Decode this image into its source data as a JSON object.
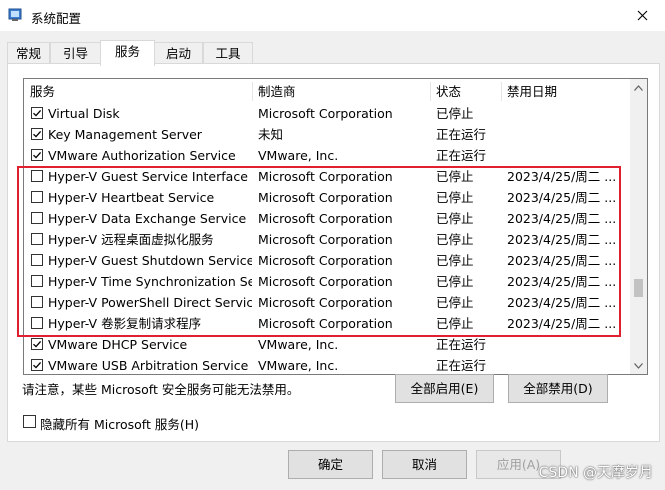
{
  "window": {
    "title": "系统配置"
  },
  "tabs": [
    {
      "label": "常规"
    },
    {
      "label": "引导"
    },
    {
      "label": "服务"
    },
    {
      "label": "启动"
    },
    {
      "label": "工具"
    }
  ],
  "table": {
    "headers": {
      "service": "服务",
      "manufacturer": "制造商",
      "status": "状态",
      "disabled_date": "禁用日期"
    },
    "rows": [
      {
        "checked": true,
        "service": "Virtual Disk",
        "manufacturer": "Microsoft Corporation",
        "status": "已停止",
        "date": ""
      },
      {
        "checked": true,
        "service": "Key Management Server",
        "manufacturer": "未知",
        "status": "正在运行",
        "date": ""
      },
      {
        "checked": true,
        "service": "VMware Authorization Service",
        "manufacturer": "VMware, Inc.",
        "status": "正在运行",
        "date": ""
      },
      {
        "checked": false,
        "service": "Hyper-V Guest Service Interface",
        "manufacturer": "Microsoft Corporation",
        "status": "已停止",
        "date": "2023/4/25/周二 ..."
      },
      {
        "checked": false,
        "service": "Hyper-V Heartbeat Service",
        "manufacturer": "Microsoft Corporation",
        "status": "已停止",
        "date": "2023/4/25/周二 ..."
      },
      {
        "checked": false,
        "service": "Hyper-V Data Exchange Service",
        "manufacturer": "Microsoft Corporation",
        "status": "已停止",
        "date": "2023/4/25/周二 ..."
      },
      {
        "checked": false,
        "service": "Hyper-V 远程桌面虚拟化服务",
        "manufacturer": "Microsoft Corporation",
        "status": "已停止",
        "date": "2023/4/25/周二 ..."
      },
      {
        "checked": false,
        "service": "Hyper-V Guest Shutdown Service",
        "manufacturer": "Microsoft Corporation",
        "status": "已停止",
        "date": "2023/4/25/周二 ..."
      },
      {
        "checked": false,
        "service": "Hyper-V Time Synchronization Se...",
        "manufacturer": "Microsoft Corporation",
        "status": "已停止",
        "date": "2023/4/25/周二 ..."
      },
      {
        "checked": false,
        "service": "Hyper-V PowerShell Direct Service",
        "manufacturer": "Microsoft Corporation",
        "status": "已停止",
        "date": "2023/4/25/周二 ..."
      },
      {
        "checked": false,
        "service": "Hyper-V 卷影复制请求程序",
        "manufacturer": "Microsoft Corporation",
        "status": "已停止",
        "date": "2023/4/25/周二 ..."
      },
      {
        "checked": true,
        "service": "VMware DHCP Service",
        "manufacturer": "VMware, Inc.",
        "status": "正在运行",
        "date": ""
      },
      {
        "checked": true,
        "service": "VMware USB Arbitration Service",
        "manufacturer": "VMware, Inc.",
        "status": "正在运行",
        "date": ""
      }
    ]
  },
  "notice": "请注意，某些 Microsoft 安全服务可能无法禁用。",
  "buttons": {
    "enable_all": "全部启用(E)",
    "disable_all": "全部禁用(D)",
    "ok": "确定",
    "cancel": "取消",
    "apply": "应用(A)"
  },
  "hide_ms": {
    "label": "隐藏所有 Microsoft 服务(H)",
    "checked": false
  },
  "watermark": "CSDN @天摩岁月",
  "colors": {
    "highlight_box": "#e0202e"
  }
}
